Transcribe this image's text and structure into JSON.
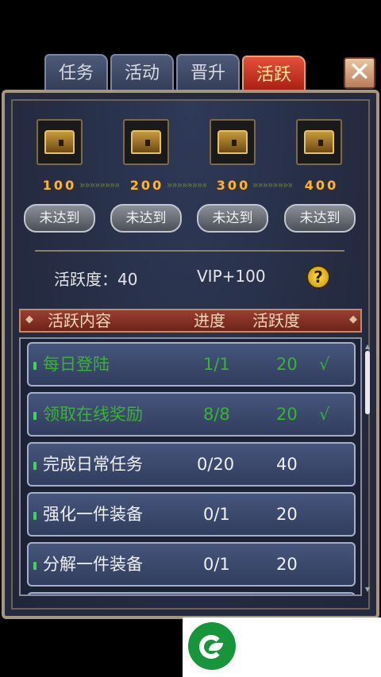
{
  "tabs": [
    {
      "label": "任务",
      "active": false
    },
    {
      "label": "活动",
      "active": false
    },
    {
      "label": "晋升",
      "active": false
    },
    {
      "label": "活跃",
      "active": true
    }
  ],
  "close_label": "✕",
  "rewards": [
    {
      "threshold": "100",
      "button": "未达到"
    },
    {
      "threshold": "200",
      "button": "未达到"
    },
    {
      "threshold": "300",
      "button": "未达到"
    },
    {
      "threshold": "400",
      "button": "未达到"
    }
  ],
  "arrows": "»»»»»»»»»",
  "activity_label": "活跃度：40",
  "vip_label": "VIP+100",
  "help_label": "?",
  "header": {
    "content": "活跃内容",
    "progress": "进度",
    "activity": "活跃度"
  },
  "tasks": [
    {
      "name": "每日登陆",
      "progress": "1/1",
      "points": "20",
      "check": "√",
      "done": true
    },
    {
      "name": "领取在线奖励",
      "progress": "8/8",
      "points": "20",
      "check": "√",
      "done": true
    },
    {
      "name": "完成日常任务",
      "progress": "0/20",
      "points": "40",
      "check": "",
      "done": false
    },
    {
      "name": "强化一件装备",
      "progress": "0/1",
      "points": "20",
      "check": "",
      "done": false
    },
    {
      "name": "分解一件装备",
      "progress": "0/1",
      "points": "20",
      "check": "",
      "done": false
    }
  ],
  "colors": {
    "done_text": "#36b52f",
    "threshold": "#f7b733",
    "active_tab": "#c8321f"
  }
}
